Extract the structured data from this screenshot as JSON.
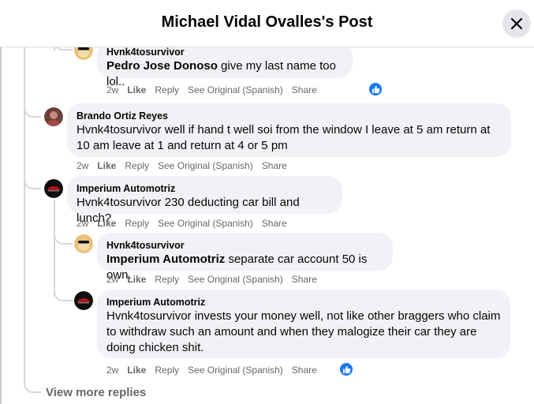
{
  "header": {
    "title": "Michael Vidal Ovalles's Post"
  },
  "actions": {
    "like": "Like",
    "reply": "Reply",
    "see_original": "See Original (Spanish)",
    "share": "Share"
  },
  "comments": [
    {
      "author": "Hvnk4tosurvivor",
      "mention": "Pedro Jose Donoso",
      "text": " give my last name too lol..",
      "time": "2w",
      "reacted": true
    },
    {
      "author": "Brando Ortiz Reyes",
      "mention": "",
      "text": "Hvnk4tosurvivor well if hand t well soi from the window I leave at 5 am return at 10 am leave at 1 and return at 4 or 5 pm",
      "time": "2w",
      "reacted": false
    },
    {
      "author": "Imperium Automotriz",
      "mention": "",
      "text": "Hvnk4tosurvivor 230 deducting car bill and lunch?",
      "time": "2w",
      "reacted": false
    },
    {
      "author": "Hvnk4tosurvivor",
      "mention": "Imperium Automotriz",
      "text": " separate car account 50 is own.",
      "time": "2w",
      "reacted": false
    },
    {
      "author": "Imperium Automotriz",
      "mention": "",
      "text": "Hvnk4tosurvivor invests your money well, not like other braggers who claim to withdraw such an amount and when they malogize their car they are doing chicken shit.",
      "time": "2w",
      "reacted": true
    }
  ],
  "view_more": "View more replies",
  "colors": {
    "accent": "#1877f2",
    "bubble": "#f0f2f5",
    "meta": "#65676b"
  }
}
